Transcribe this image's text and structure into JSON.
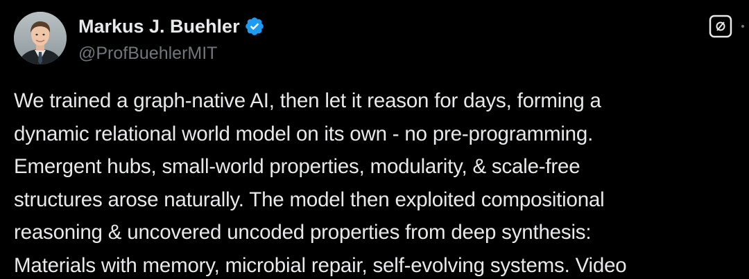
{
  "author": {
    "display_name": "Markus J. Buehler",
    "handle": "@ProfBuehlerMIT",
    "verified": true,
    "avatar_icon": "profile-photo"
  },
  "actions": {
    "grok_icon": "grok-icon",
    "more_icon": "more-options-icon"
  },
  "colors": {
    "background": "#000000",
    "text": "#e7e9ea",
    "secondary_text": "#71767b",
    "verified_badge": "#1d9bf0"
  },
  "tweet": {
    "lines": [
      "We trained a graph-native AI, then let it reason for days, forming a",
      "dynamic relational world model on its own - no pre-programming.",
      "Emergent hubs, small-world properties, modularity, & scale-free",
      "structures arose naturally. The model then exploited compositional",
      "reasoning & uncovered uncoded properties from deep synthesis:",
      "Materials with memory, microbial repair, self-evolving systems. Video"
    ]
  }
}
